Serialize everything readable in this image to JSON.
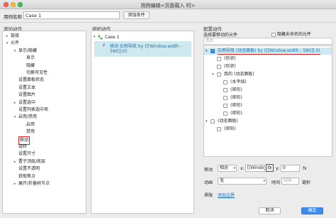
{
  "window": {
    "title": "用例编辑<页面载入 时>"
  },
  "name_row": {
    "label": "用例名称",
    "value": "Case 1",
    "add_condition": "添加条件"
  },
  "columns": {
    "add_action": "添加动作",
    "organize_action": "组织动作",
    "config_action": "配置动作"
  },
  "left_tree": [
    {
      "label": "链接",
      "depth": 0,
      "arrow": "▸"
    },
    {
      "label": "元件",
      "depth": 0,
      "arrow": "▾"
    },
    {
      "label": "显示/隐藏",
      "depth": 1,
      "arrow": "▾"
    },
    {
      "label": "显示",
      "depth": 2,
      "arrow": ""
    },
    {
      "label": "隐藏",
      "depth": 2,
      "arrow": ""
    },
    {
      "label": "切换可见性",
      "depth": 2,
      "arrow": ""
    },
    {
      "label": "设置面板状态",
      "depth": 1,
      "arrow": ""
    },
    {
      "label": "设置文本",
      "depth": 1,
      "arrow": ""
    },
    {
      "label": "设置图片",
      "depth": 1,
      "arrow": ""
    },
    {
      "label": "设置选中",
      "depth": 1,
      "arrow": "▸"
    },
    {
      "label": "设置列表选中项",
      "depth": 1,
      "arrow": ""
    },
    {
      "label": "启用/禁用",
      "depth": 1,
      "arrow": "▾"
    },
    {
      "label": "启用",
      "depth": 2,
      "arrow": ""
    },
    {
      "label": "禁用",
      "depth": 2,
      "arrow": ""
    },
    {
      "label": "移动",
      "depth": 1,
      "arrow": "",
      "highlight": true
    },
    {
      "label": "旋转",
      "depth": 1,
      "arrow": ""
    },
    {
      "label": "设置尺寸",
      "depth": 1,
      "arrow": ""
    },
    {
      "label": "置于顶层/底层",
      "depth": 1,
      "arrow": "▸"
    },
    {
      "label": "设置不透明",
      "depth": 1,
      "arrow": ""
    },
    {
      "label": "获取焦点",
      "depth": 1,
      "arrow": ""
    },
    {
      "label": "展开/折叠树节点",
      "depth": 1,
      "arrow": "▸"
    }
  ],
  "middle": {
    "case_label": "Case 1",
    "action_line1": "移动 右侧导航 by ([[Window.width -",
    "action_line2": "580]],0)"
  },
  "right": {
    "select_title": "选择要移动的元件",
    "hide_unnamed": "隐藏未命名的元件",
    "search_placeholder": "查找",
    "tree": [
      {
        "label": "右侧导航 (动态面板) by ([[Window.width - 580]],0)",
        "depth": 0,
        "arrow": "▾",
        "checked": true,
        "selected": true
      },
      {
        "label": "(形状)",
        "depth": 1,
        "arrow": "",
        "checked": false
      },
      {
        "label": "(形状)",
        "depth": 1,
        "arrow": "",
        "checked": false
      },
      {
        "label": "我的 (动态面板)",
        "depth": 1,
        "arrow": "▾",
        "checked": false
      },
      {
        "label": "(水平线)",
        "depth": 2,
        "arrow": "",
        "checked": false
      },
      {
        "label": "(矩形)",
        "depth": 2,
        "arrow": "",
        "checked": false
      },
      {
        "label": "(矩形)",
        "depth": 2,
        "arrow": "",
        "checked": false
      },
      {
        "label": "(矩形)",
        "depth": 2,
        "arrow": "",
        "checked": false
      },
      {
        "label": "(矩形)",
        "depth": 2,
        "arrow": "",
        "checked": false
      },
      {
        "label": "(动态面板)",
        "depth": 0,
        "arrow": "▾",
        "checked": false
      },
      {
        "label": "(矩形)",
        "depth": 1,
        "arrow": "",
        "checked": false
      }
    ],
    "move_label": "移动",
    "move_mode": "相对",
    "x_label": "x:",
    "x_value": "[[Window.width - 580]]",
    "fx": "fx",
    "y_label": "y:",
    "y_value": "0",
    "anim_label": "动画",
    "anim_value": "无",
    "time_label": "时间",
    "time_value": "500",
    "ms_label": "毫秒",
    "boundary_label": "界限",
    "add_boundary": "添加边界"
  },
  "footer": {
    "cancel": "取消",
    "ok": "确定"
  },
  "colors": {
    "accent": "#3b8ef0",
    "selection": "#cfe9f0",
    "highlight_red": "#e02020",
    "link_blue": "#1b6fa8"
  }
}
